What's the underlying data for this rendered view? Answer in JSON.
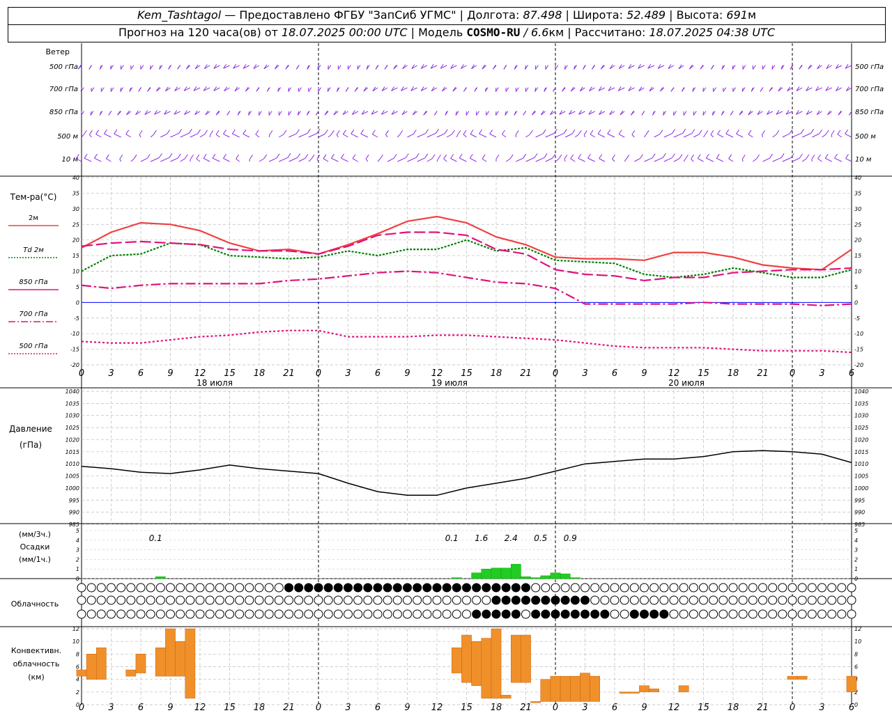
{
  "header": {
    "station": "Kem_Tashtagol",
    "dash": " — ",
    "provider": "Предоставлено ФГБУ \"ЗапСиб УГМС\"",
    "sep": " | ",
    "lon_label": "Долгота:",
    "lon_value": "87.498",
    "lat_label": "Широта:",
    "lat_value": "52.489",
    "alt_label": "Высота:",
    "alt_value": "691",
    "alt_unit": "м",
    "forecast_label": "Прогноз на 120 часа(ов) от",
    "forecast_start": "18.07.2025 00:00 UTC",
    "model_label": "Модель",
    "model_name": "COSMO-RU",
    "model_res": " / 6.6",
    "model_res_unit": "км",
    "calc_label": "Рассчитано:",
    "calc_time": "18.07.2025 04:38 UTC"
  },
  "labels": {
    "wind": "Ветер",
    "levels": [
      "500 гПа",
      "700 гПа",
      "850 гПа",
      "500 м",
      "10  м"
    ],
    "temp_title": "Тем-ра(°C)",
    "legend": [
      "2м",
      "Td  2м",
      "850 гПа",
      "700 гПа",
      "500 гПа"
    ],
    "pressure_title": "Давление",
    "pressure_unit": "(гПа)",
    "precip_unit_top": "(мм/3ч.)",
    "precip_title": "Осадки",
    "precip_unit_bottom": "(мм/1ч.)",
    "cloud_title": "Облачность",
    "conv_title": [
      "Конвективн.",
      "облачность",
      "(км)"
    ],
    "hour_ticks": [
      "0",
      "3",
      "6",
      "9",
      "12",
      "15",
      "18",
      "21",
      "0",
      "3",
      "6",
      "9",
      "12",
      "15",
      "18",
      "21",
      "0",
      "3",
      "6",
      "9",
      "12",
      "15",
      "18",
      "21",
      "0",
      "3",
      "6"
    ],
    "days": [
      "18 июля",
      "19 июля",
      "20 июля"
    ]
  },
  "colors": {
    "t2m": "#f04040",
    "td2m": "#007f00",
    "t850": "#e0107c",
    "t700": "#e0107c",
    "t500": "#e0107c",
    "wind": "#8a2be2",
    "precip": "#22cc22",
    "convective": "#f0902a",
    "pressure": "#000000",
    "zero_line": "#0000ff"
  },
  "chart_data": [
    {
      "type": "line",
      "title": "Тем-ра(°C)",
      "x_unit": "hours since 18.07.2025 00:00 UTC",
      "x": [
        0,
        3,
        6,
        9,
        12,
        15,
        18,
        21,
        24,
        27,
        30,
        33,
        36,
        39,
        42,
        45,
        48,
        51,
        54,
        57,
        60,
        63,
        66,
        69,
        72,
        75,
        78
      ],
      "ylim": [
        -20,
        40
      ],
      "series": [
        {
          "name": "2м",
          "values": [
            17.5,
            22.5,
            25.5,
            25,
            23,
            19,
            16.5,
            17,
            15.5,
            18.5,
            22,
            26,
            27.5,
            25.5,
            21,
            18.5,
            14.5,
            14,
            14,
            13.5,
            16,
            16,
            14.5,
            12,
            11,
            10.5,
            17
          ]
        },
        {
          "name": "Td  2м",
          "values": [
            10,
            15,
            15.5,
            19,
            18.5,
            15,
            14.5,
            14,
            14.5,
            16.5,
            15,
            17,
            17,
            20,
            16.5,
            17.5,
            13.5,
            13,
            12.5,
            9,
            8,
            9,
            11,
            9.5,
            8,
            8,
            10.5
          ]
        },
        {
          "name": "850 гПа",
          "values": [
            18,
            19,
            19.5,
            19,
            18.5,
            17,
            16.5,
            16.5,
            15.5,
            18,
            21.5,
            22.5,
            22.5,
            21.5,
            17,
            15.5,
            10.5,
            9,
            8.5,
            7,
            8,
            8,
            9.5,
            10,
            10.5,
            10.5,
            11
          ]
        },
        {
          "name": "700 гПа",
          "values": [
            5.5,
            4.5,
            5.5,
            6,
            6,
            6,
            6,
            7,
            7.5,
            8.5,
            9.5,
            10,
            9.5,
            8,
            6.5,
            6,
            4.5,
            -0.5,
            -0.5,
            -0.5,
            -0.5,
            0,
            -0.5,
            -0.5,
            -0.5,
            -1,
            -0.5
          ]
        },
        {
          "name": "500 гПа",
          "values": [
            -12.5,
            -13,
            -13,
            -12,
            -11,
            -10.5,
            -9.5,
            -9,
            -9,
            -11,
            -11,
            -11,
            -10.5,
            -10.5,
            -11,
            -11.5,
            -12,
            -13,
            -14,
            -14.5,
            -14.5,
            -14.5,
            -15,
            -15.5,
            -15.5,
            -15.5,
            -16
          ]
        }
      ]
    },
    {
      "type": "line",
      "title": "Давление",
      "ylabel": "(гПа)",
      "x": [
        0,
        3,
        6,
        9,
        12,
        15,
        18,
        21,
        24,
        27,
        30,
        33,
        36,
        39,
        42,
        45,
        48,
        51,
        54,
        57,
        60,
        63,
        66,
        69,
        72,
        75,
        78
      ],
      "ylim": [
        985,
        1040
      ],
      "series": [
        {
          "name": "",
          "values": [
            1009,
            1008,
            1006.5,
            1006,
            1007.5,
            1009.5,
            1008,
            1007,
            1006,
            1002,
            998.5,
            997,
            997,
            1000,
            1002,
            1004,
            1007,
            1010,
            1011,
            1012,
            1012,
            1013,
            1015,
            1015.5,
            1015,
            1014,
            1010.5
          ]
        }
      ]
    },
    {
      "type": "bar",
      "title": "Осадки",
      "ylabel": "(мм/1ч.)",
      "ylim": [
        0,
        5
      ],
      "labels_3h": [
        {
          "x": 7.5,
          "text": "0.1"
        },
        {
          "x": 37.5,
          "text": "0.1"
        },
        {
          "x": 40.5,
          "text": "1.6"
        },
        {
          "x": 43.5,
          "text": "2.4"
        },
        {
          "x": 46.5,
          "text": "0.5"
        },
        {
          "x": 49.5,
          "text": "0.9"
        }
      ],
      "bars": [
        {
          "x": 8,
          "value": 0.2
        },
        {
          "x": 38,
          "value": 0.1
        },
        {
          "x": 40,
          "value": 0.6
        },
        {
          "x": 41,
          "value": 1.0
        },
        {
          "x": 42,
          "value": 1.1
        },
        {
          "x": 43,
          "value": 1.1
        },
        {
          "x": 44,
          "value": 1.5
        },
        {
          "x": 45,
          "value": 0.2
        },
        {
          "x": 46,
          "value": 0.1
        },
        {
          "x": 47,
          "value": 0.3
        },
        {
          "x": 48,
          "value": 0.6
        },
        {
          "x": 49,
          "value": 0.5
        },
        {
          "x": 50,
          "value": 0.1
        }
      ]
    },
    {
      "type": "bar",
      "title": "Конвективн. облачность",
      "ylabel": "(км)",
      "ylim": [
        0,
        12
      ],
      "bars": [
        {
          "x": 0,
          "bottom": 4.5,
          "top": 5.5
        },
        {
          "x": 1,
          "bottom": 4,
          "top": 8
        },
        {
          "x": 2,
          "bottom": 4,
          "top": 9
        },
        {
          "x": 5,
          "bottom": 4.5,
          "top": 5.5
        },
        {
          "x": 6,
          "bottom": 5,
          "top": 8
        },
        {
          "x": 8,
          "bottom": 4.5,
          "top": 9
        },
        {
          "x": 9,
          "bottom": 4.5,
          "top": 12
        },
        {
          "x": 10,
          "bottom": 4.5,
          "top": 10
        },
        {
          "x": 11,
          "bottom": 1,
          "top": 12
        },
        {
          "x": 38,
          "bottom": 5,
          "top": 9
        },
        {
          "x": 39,
          "bottom": 3.5,
          "top": 11
        },
        {
          "x": 40,
          "bottom": 3,
          "top": 10
        },
        {
          "x": 41,
          "bottom": 1,
          "top": 10.5
        },
        {
          "x": 42,
          "bottom": 1,
          "top": 12
        },
        {
          "x": 43,
          "bottom": 1,
          "top": 1.5
        },
        {
          "x": 44,
          "bottom": 3.5,
          "top": 11
        },
        {
          "x": 45,
          "bottom": 3.5,
          "top": 11
        },
        {
          "x": 46,
          "bottom": 0.3,
          "top": 0.5
        },
        {
          "x": 47,
          "bottom": 0.5,
          "top": 4
        },
        {
          "x": 48,
          "bottom": 0.5,
          "top": 4.5
        },
        {
          "x": 49,
          "bottom": 0.5,
          "top": 4.5
        },
        {
          "x": 50,
          "bottom": 0.5,
          "top": 4.5
        },
        {
          "x": 51,
          "bottom": 0.5,
          "top": 5
        },
        {
          "x": 52,
          "bottom": 0.5,
          "top": 4.5
        },
        {
          "x": 55,
          "bottom": 1.8,
          "top": 2
        },
        {
          "x": 56,
          "bottom": 1.8,
          "top": 2
        },
        {
          "x": 57,
          "bottom": 2,
          "top": 3
        },
        {
          "x": 58,
          "bottom": 2,
          "top": 2.5
        },
        {
          "x": 61,
          "bottom": 2,
          "top": 3
        },
        {
          "x": 72,
          "bottom": 4,
          "top": 4.5
        },
        {
          "x": 73,
          "bottom": 4,
          "top": 4.5
        },
        {
          "x": 78,
          "bottom": 2,
          "top": 4.5
        }
      ]
    }
  ]
}
